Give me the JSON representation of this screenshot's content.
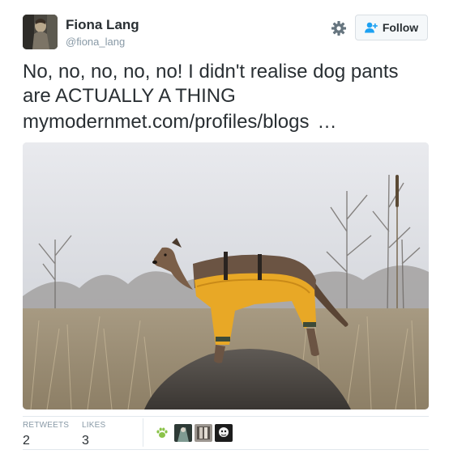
{
  "tweet": {
    "author": {
      "name": "Fiona Lang",
      "handle": "@fiona_lang",
      "avatar_icon": "profile-photo"
    },
    "follow_button": {
      "label": "Follow",
      "icon": "add-user-icon"
    },
    "settings_icon": "gear-icon",
    "text": "No, no, no, no, no! I didn't realise dog pants are ACTUALLY A THING",
    "link": {
      "url_text": "mymodernmet.com/profiles/blogs",
      "ellipsis": "…"
    },
    "media": {
      "subject": "dog wearing yellow rain pants standing on a rock in a field"
    },
    "stats": {
      "retweets_label": "RETWEETS",
      "retweets_count": "2",
      "likes_label": "LIKES",
      "likes_count": "3"
    },
    "likers": [
      "paw-icon",
      "liker-avatar-1",
      "liker-avatar-2",
      "liker-avatar-3"
    ]
  },
  "colors": {
    "text": "#292f33",
    "muted": "#8899a6",
    "divider": "#e1e8ed",
    "follow_accent": "#1da1f2",
    "paw_green": "#8bc34a"
  }
}
